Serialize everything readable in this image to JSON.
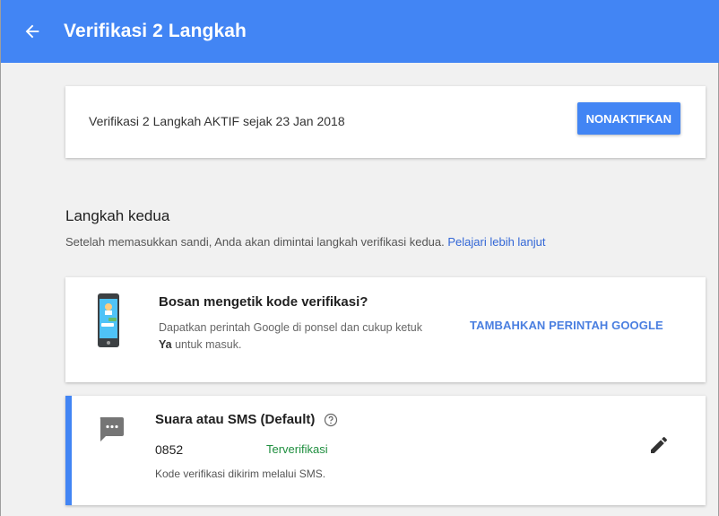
{
  "header": {
    "title": "Verifikasi 2 Langkah",
    "back_icon": "arrow-back-icon",
    "background": "#4285f4"
  },
  "status_card": {
    "text": "Verifikasi 2 Langkah AKTIF sejak 23 Jan 2018",
    "button_label": "NONAKTIFKAN"
  },
  "second_step": {
    "title": "Langkah kedua",
    "description": "Setelah memasukkan sandi, Anda akan dimintai langkah verifikasi kedua.",
    "link": "Pelajari lebih lanjut"
  },
  "promo_card": {
    "icon": "phone-icon",
    "title": "Bosan mengetik kode verifikasi?",
    "description": "Dapatkan perintah Google di ponsel dan cukup ketuk",
    "description_bold": "Ya",
    "description_end": "untuk masuk.",
    "action": "TAMBAHKAN PERINTAH GOOGLE"
  },
  "sms_card": {
    "icon": "sms-icon",
    "title": "Suara atau SMS (Default)",
    "help_icon": "help-icon",
    "phone": "0852",
    "status": "Terverifikasi",
    "description": "Kode verifikasi dikirim melalui SMS.",
    "edit_icon": "edit-icon",
    "accent_color": "#4285f4",
    "status_color": "#1e8e3e"
  }
}
